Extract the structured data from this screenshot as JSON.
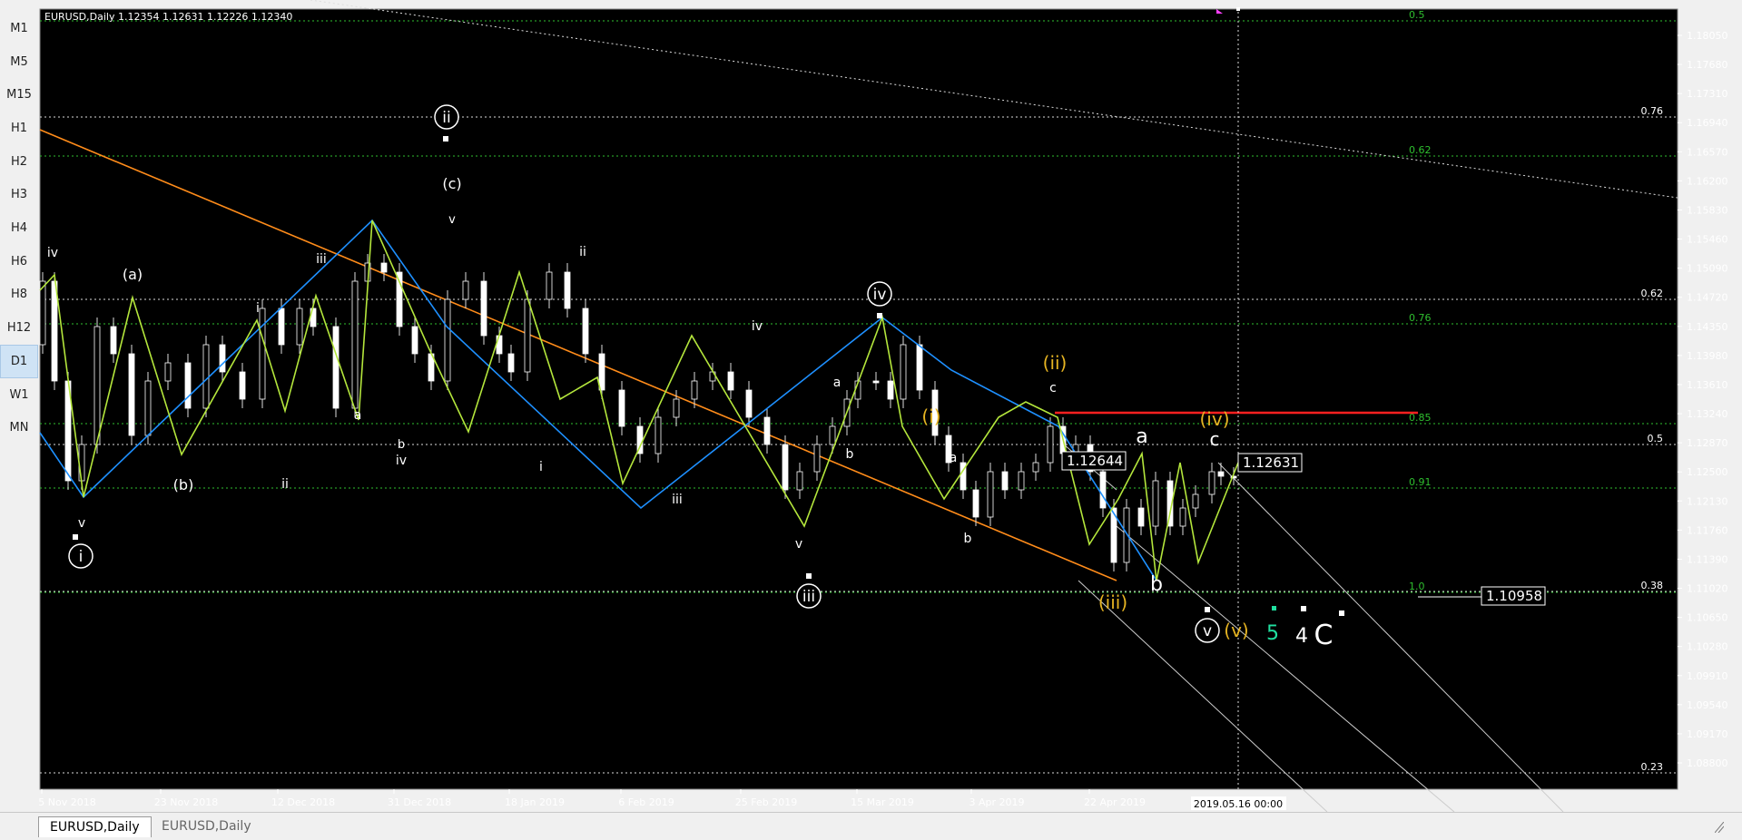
{
  "sidebar": {
    "items": [
      {
        "label": "M1",
        "active": false
      },
      {
        "label": "M5",
        "active": false
      },
      {
        "label": "M15",
        "active": false
      },
      {
        "label": "H1",
        "active": false
      },
      {
        "label": "H2",
        "active": false
      },
      {
        "label": "H3",
        "active": false
      },
      {
        "label": "H4",
        "active": false
      },
      {
        "label": "H6",
        "active": false
      },
      {
        "label": "H8",
        "active": false
      },
      {
        "label": "H12",
        "active": false
      },
      {
        "label": "D1",
        "active": true
      },
      {
        "label": "W1",
        "active": false
      },
      {
        "label": "MN",
        "active": false
      }
    ]
  },
  "chart": {
    "header": "EURUSD,Daily  1.12354 1.12631 1.12226 1.12340",
    "symbol_timeframe": "EURUSD,Daily",
    "ohlc": {
      "open": 1.12354,
      "high": 1.12631,
      "low": 1.12226,
      "close": 1.1234
    },
    "background": "#000000",
    "price_axis": [
      "1.18050",
      "1.17680",
      "1.17310",
      "1.16940",
      "1.16570",
      "1.16200",
      "1.15830",
      "1.15460",
      "1.15090",
      "1.14720",
      "1.14350",
      "1.13980",
      "1.13610",
      "1.13240",
      "1.12870",
      "1.12500",
      "1.12130",
      "1.11760",
      "1.11390",
      "1.11020",
      "1.10650",
      "1.10280",
      "1.09910",
      "1.09540",
      "1.09170",
      "1.08800"
    ],
    "time_axis": [
      "5 Nov 2018",
      "23 Nov 2018",
      "12 Dec 2018",
      "31 Dec 2018",
      "18 Jan 2019",
      "6 Feb 2019",
      "25 Feb 2019",
      "15 Mar 2019",
      "3 Apr 2019",
      "22 Apr 2019"
    ],
    "crosshair_date": "2019.05.16 00:00",
    "price_labels": {
      "current": "1.12631",
      "marked": "1.12644",
      "bottom": "1.10958"
    },
    "fib_levels_green": [
      "0.5",
      "0.62",
      "0.76",
      "0.85",
      "0.91",
      "1.0"
    ],
    "fib_levels_white": [
      "0.76",
      "0.62",
      "0.5",
      "0.38",
      "0.23"
    ],
    "wave_labels": {
      "major": [
        "i",
        "ii",
        "iii",
        "iv",
        "v"
      ],
      "orange": [
        "(i)",
        "(ii)",
        "(iii)",
        "(iv)",
        "(v)"
      ],
      "minor_white": [
        "iv",
        "(a)",
        "(b)",
        "i",
        "ii",
        "iii",
        "a",
        "b",
        "c",
        "iv",
        "(c)",
        "v",
        "ii",
        "i",
        "iii",
        "iv",
        "v",
        "a",
        "b",
        "a",
        "b",
        "c",
        "v"
      ],
      "abc_big": [
        "a",
        "b",
        "c"
      ],
      "right_labels": {
        "five": "5",
        "four": "4",
        "big_c": "C"
      }
    },
    "colors": {
      "blue_line": "#1e90ff",
      "green_line": "#9acd32",
      "orange_line": "#ff8c1a",
      "red_line": "#ff2020",
      "orange_text": "#e6b422",
      "fib_green": "#2fbf2f",
      "teal_text": "#20e0a0",
      "magenta": "#ff40ff"
    }
  },
  "tabs": [
    {
      "label": "EURUSD,Daily",
      "active": true
    },
    {
      "label": "EURUSD,Daily",
      "active": false
    }
  ]
}
